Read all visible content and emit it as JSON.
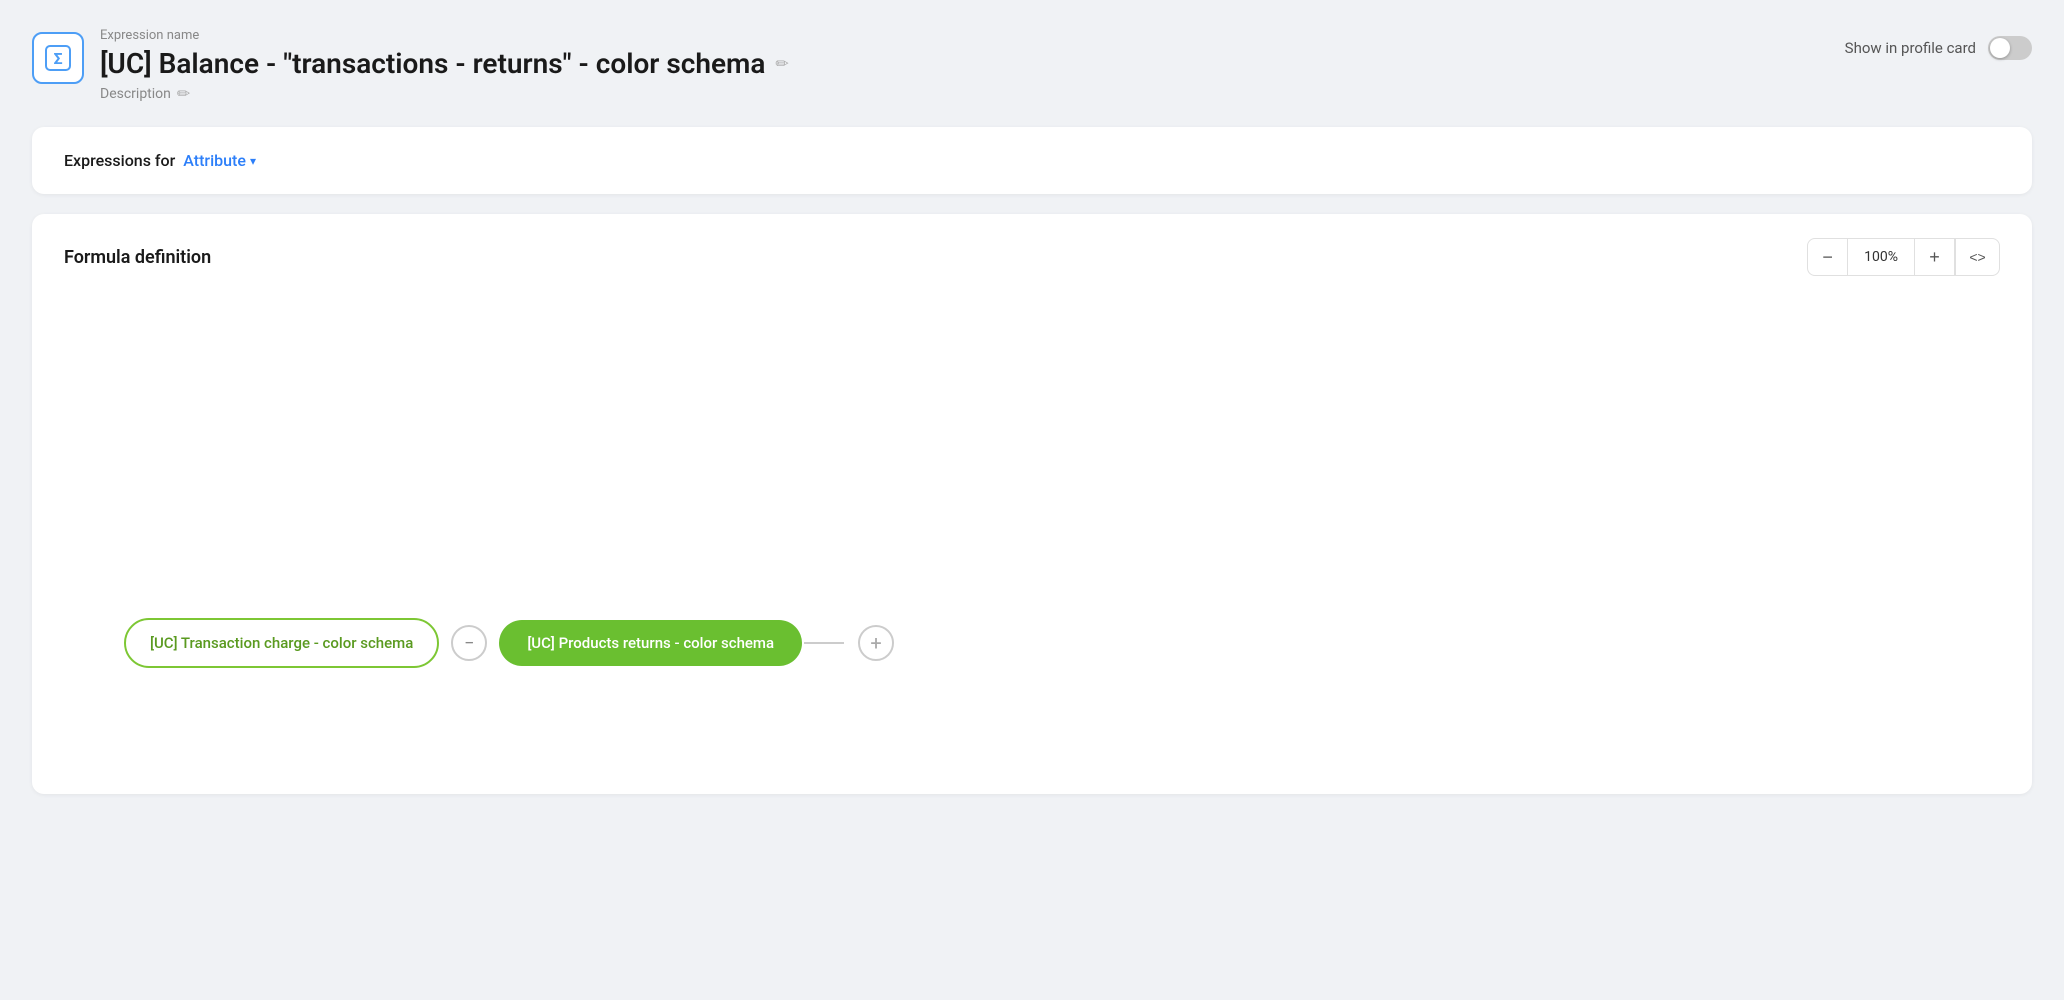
{
  "header": {
    "expression_name_label": "Expression name",
    "title": "[UC] Balance - \"transactions - returns\" - color schema",
    "description_label": "Description",
    "show_in_profile_card_label": "Show in profile card",
    "toggle_enabled": false
  },
  "expressions_for": {
    "label": "Expressions for",
    "attribute_label": "Attribute",
    "chevron": "▾"
  },
  "formula": {
    "title": "Formula definition",
    "zoom": "100%",
    "zoom_minus_label": "−",
    "zoom_plus_label": "+",
    "code_label": "<>",
    "node1_label": "[UC] Transaction charge - color schema",
    "operator_label": "−",
    "node2_label": "[UC] Products returns - color schema",
    "add_label": "+"
  }
}
